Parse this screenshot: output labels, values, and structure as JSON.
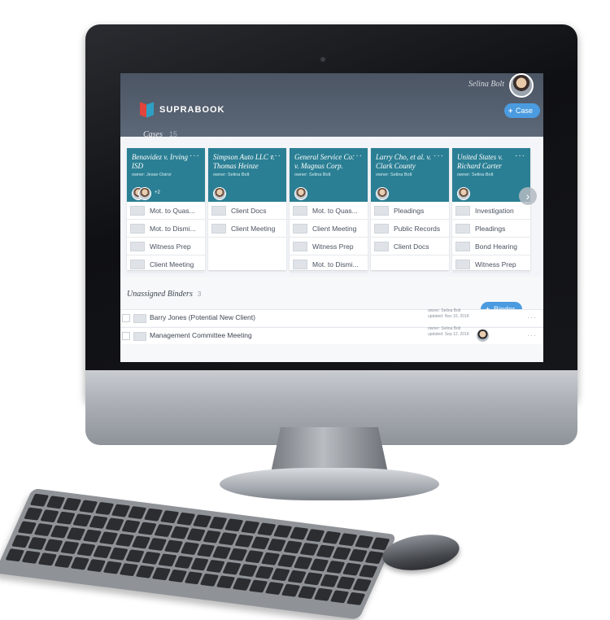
{
  "app": {
    "brand": "SUPRABOOK",
    "user_name": "Selina Bolt",
    "add_case_label": "Case",
    "add_binder_label": "Binder"
  },
  "cases": {
    "title": "Cases",
    "count": "15",
    "items": [
      {
        "title": "Benavidez v. Irving ISD",
        "owner": "owner: Jesse Osiror",
        "extra": "+2",
        "binders": [
          "Mot. to Quas...",
          "Mot. to Dismi...",
          "Witness Prep",
          "Client Meeting"
        ]
      },
      {
        "title": "Simpson Auto LLC v. Thomas Heinze",
        "owner": "owner: Selina Bolt",
        "extra": "",
        "binders": [
          "Client Docs",
          "Client Meeting"
        ]
      },
      {
        "title": "General Service Co. v. Magnus Corp.",
        "owner": "owner: Selina Bolt",
        "extra": "",
        "binders": [
          "Mot. to Quas...",
          "Client Meeting",
          "Witness Prep",
          "Mot. to Dismi..."
        ]
      },
      {
        "title": "Larry Cho, et al. v. Clark County",
        "owner": "owner: Selina Bolt",
        "extra": "",
        "binders": [
          "Pleadings",
          "Public Records",
          "Client Docs"
        ]
      },
      {
        "title": "United States v. Richard Carter",
        "owner": "owner: Selina Bolt",
        "extra": "",
        "binders": [
          "Investigation",
          "Pleadings",
          "Bond Hearing",
          "Witness Prep"
        ]
      }
    ]
  },
  "unassigned": {
    "title": "Unassigned Binders",
    "count": "3",
    "rows": [
      {
        "name": "Barry Jones (Potential New Client)",
        "owner": "owner: Selina Bolt",
        "updated": "updated: Nov 16, 2018"
      },
      {
        "name": "Management Committee Meeting",
        "owner": "owner: Selina Bolt",
        "updated": "updated: Sep 12, 2018"
      }
    ]
  },
  "icons": {
    "search": "search-icon",
    "more": "more-icon",
    "next": "chevron-right-icon"
  },
  "colors": {
    "accent": "#4a9be0",
    "case_header": "#2b7f94",
    "topbar": "#4b5564",
    "logo_red": "#e0443c",
    "logo_blue": "#2e9fc4"
  }
}
